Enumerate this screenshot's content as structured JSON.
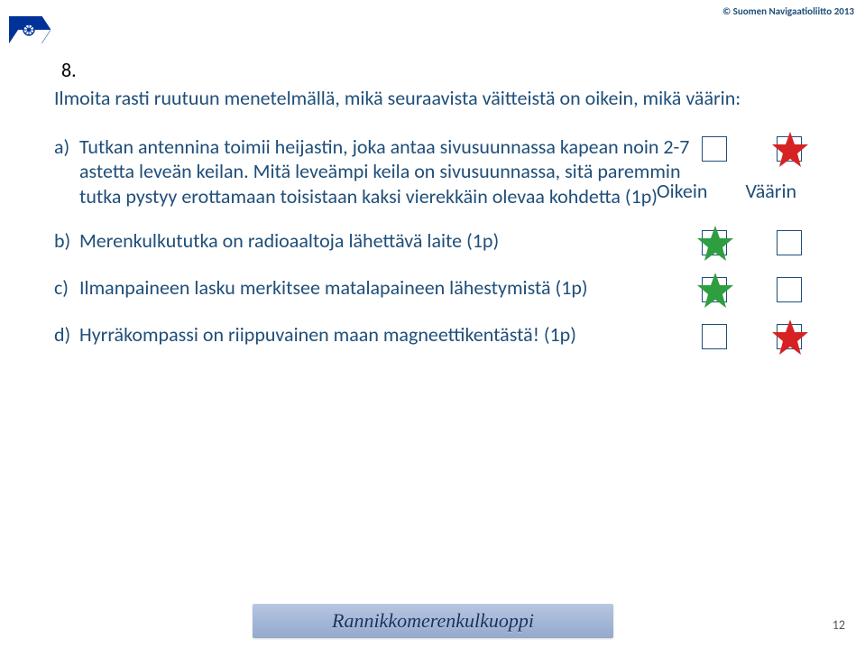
{
  "copyright": "© Suomen Navigaatioliitto 2013",
  "question_number": "8.",
  "question_text": "Ilmoita rasti ruutuun menetelmällä, mikä seuraavista väitteistä on oikein, mikä väärin:",
  "headers": {
    "correct": "Oikein",
    "wrong": "Väärin"
  },
  "items": [
    {
      "label": "a)",
      "text": "Tutkan antennina toimii heijastin, joka antaa sivusuunnassa kapean noin 2-7 astetta leveän keilan. Mitä leveämpi keila on sivusuunnassa, sitä paremmin tutka pystyy erottamaan toisistaan kaksi vierekkäin olevaa kohdetta (1p)",
      "oikein_mark": "none",
      "vaarin_mark": "red-star"
    },
    {
      "label": "b)",
      "text": "Merenkulkututka on radioaaltoja lähettävä laite (1p)",
      "oikein_mark": "green-star",
      "vaarin_mark": "none"
    },
    {
      "label": "c)",
      "text": "Ilmanpaineen lasku merkitsee matalapaineen lähestymistä (1p)",
      "oikein_mark": "green-star",
      "vaarin_mark": "none"
    },
    {
      "label": "d)",
      "text": "Hyrräkompassi on riippuvainen maan magneettikentästä! (1p)",
      "oikein_mark": "none",
      "vaarin_mark": "red-star"
    }
  ],
  "footer": "Rannikkomerenkulkuoppi",
  "page": "12"
}
